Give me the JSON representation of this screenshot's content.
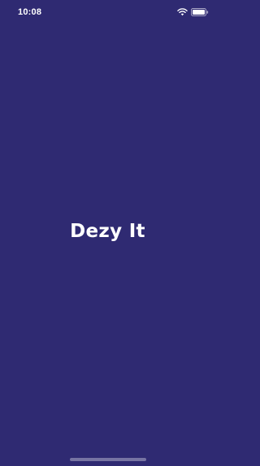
{
  "status_bar": {
    "time": "10:08",
    "wifi_icon": "wifi-icon",
    "battery_icon": "battery-icon"
  },
  "splash": {
    "title": "Dezy It"
  },
  "colors": {
    "background": "#2f2a72",
    "text": "#ffffff"
  }
}
